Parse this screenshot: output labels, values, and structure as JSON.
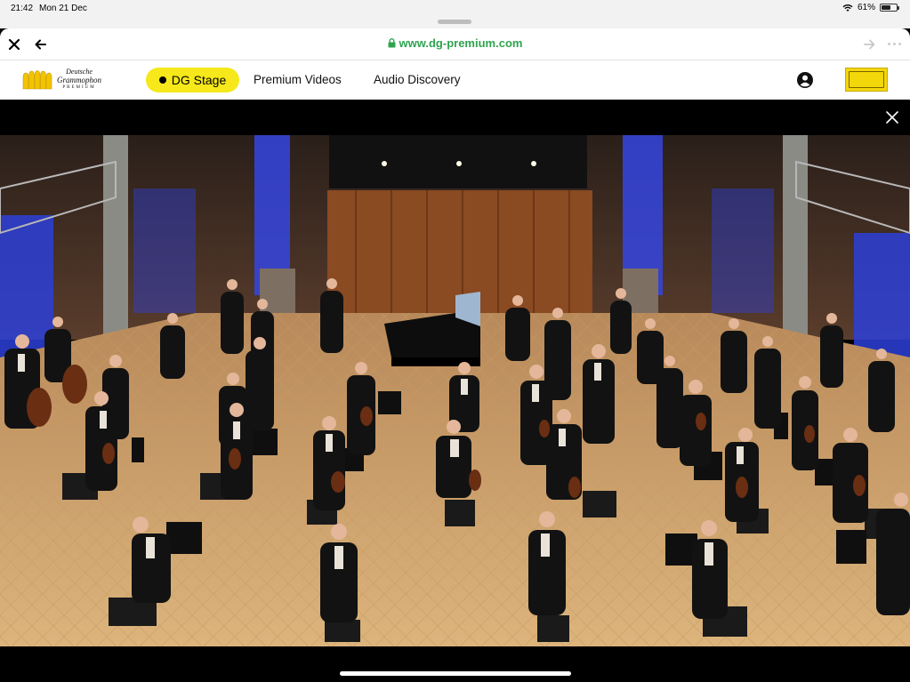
{
  "status_bar": {
    "time": "21:42",
    "date": "Mon 21 Dec",
    "battery_percent": "61%",
    "battery_level": 0.61
  },
  "browser": {
    "url": "www.dg-premium.com"
  },
  "site_nav": {
    "logo_line1": "Deutsche",
    "logo_line2": "Grammophon",
    "logo_line3": "PREMIUM",
    "items": [
      {
        "label": "DG Stage",
        "active": true
      },
      {
        "label": "Premium Videos",
        "active": false
      },
      {
        "label": "Audio Discovery",
        "active": false
      }
    ]
  },
  "colors": {
    "accent": "#f6e81a",
    "url_green": "#2ea44f",
    "stage_blue": "#2c3fd8",
    "floor": "#d9b178"
  },
  "icons": {
    "close": "close-icon",
    "back": "arrow-left-icon",
    "forward": "arrow-right-icon",
    "lock": "lock-icon",
    "account": "account-icon",
    "overlay_close": "close-icon"
  }
}
